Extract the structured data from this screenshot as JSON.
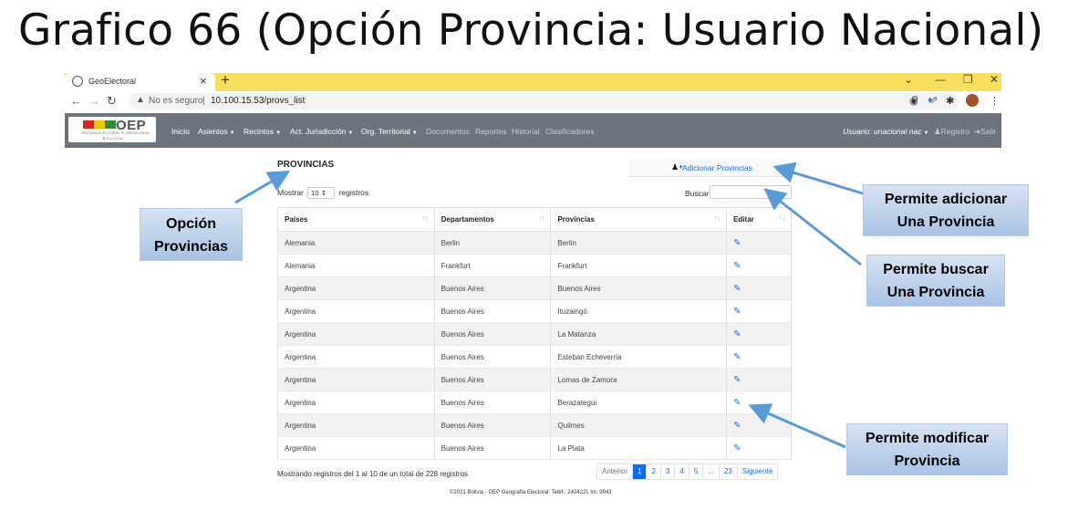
{
  "slide": {
    "title": "Grafico 66 (Opción Provincia: Usuario Nacional)"
  },
  "browser": {
    "tab_title": "GeoElectoral",
    "tab_close": "×",
    "new_tab": "+",
    "not_secure": "No es seguro",
    "url_separator": "|",
    "url": "10.100.15.53/provs_list"
  },
  "navbar": {
    "logo_text": "OEP",
    "logo_subtitle": "ÓRGANO ELECTORAL PLURINACIONAL",
    "logo_country": "BOLIVIA",
    "items": [
      {
        "label": "Inicio",
        "caret": false,
        "dim": false
      },
      {
        "label": "Asientos",
        "caret": true,
        "dim": false
      },
      {
        "label": "Recintos",
        "caret": true,
        "dim": false
      },
      {
        "label": "Act. Jurisdicción",
        "caret": true,
        "dim": false
      },
      {
        "label": "Org. Territorial",
        "caret": true,
        "dim": false
      },
      {
        "label": "Documentos",
        "caret": false,
        "dim": true
      },
      {
        "label": "Reportes",
        "caret": false,
        "dim": true
      },
      {
        "label": "Historial",
        "caret": false,
        "dim": true
      },
      {
        "label": "Clasificadores",
        "caret": false,
        "dim": true
      }
    ],
    "user_label": "Usuario: unacional nac",
    "register_label": "Registro",
    "logout_label": "Salir",
    "background": "#6c757d"
  },
  "content": {
    "title": "PROVINCIAS",
    "add_button": "Adicionar Provincias",
    "show_label": "Mostrar",
    "show_value": "10",
    "records_label": "registros",
    "search_label": "Buscar",
    "search_value": "",
    "columns": [
      "Países",
      "Departamentos",
      "Provincias",
      "Editar"
    ],
    "rows": [
      [
        "Alemania",
        "Berlin",
        "Berlin"
      ],
      [
        "Alemania",
        "Frankfurt",
        "Frankfurt"
      ],
      [
        "Argentina",
        "Buenos Aires",
        "Buenos Aires"
      ],
      [
        "Argentina",
        "Buenos Aires",
        "Ituzaingó"
      ],
      [
        "Argentina",
        "Buenos Aires",
        "La Matanza"
      ],
      [
        "Argentina",
        "Buenos Aires",
        "Esteban Echeverría"
      ],
      [
        "Argentina",
        "Buenos Aires",
        "Lomas de Zamora"
      ],
      [
        "Argentina",
        "Buenos Aires",
        "Berazategui"
      ],
      [
        "Argentina",
        "Buenos Aires",
        "Quilmes"
      ],
      [
        "Argentina",
        "Buenos Aires",
        "La Plata"
      ]
    ],
    "info": "Mostrando registros del 1 al 10 de un total de 228 registros",
    "pagination": [
      "Anterior",
      "1",
      "2",
      "3",
      "4",
      "5",
      "...",
      "23",
      "Siguiente"
    ],
    "active_page": "1",
    "footer": "©2021 Bolivia - OEP Geografía Electoral: Teléf.: 2424221 Int. 9943"
  },
  "callouts": {
    "opcion": [
      "Opción",
      "Provincias"
    ],
    "adicionar": [
      "Permite adicionar",
      "Una Provincia"
    ],
    "buscar": [
      "Permite buscar",
      "Una Provincia"
    ],
    "modificar": [
      "Permite modificar",
      "Provincia"
    ]
  },
  "colors": {
    "accent": "#0d6efd",
    "tab_strip": "#f9e05c",
    "callout": "#b8cde8",
    "arrow": "#5b9bd5"
  }
}
